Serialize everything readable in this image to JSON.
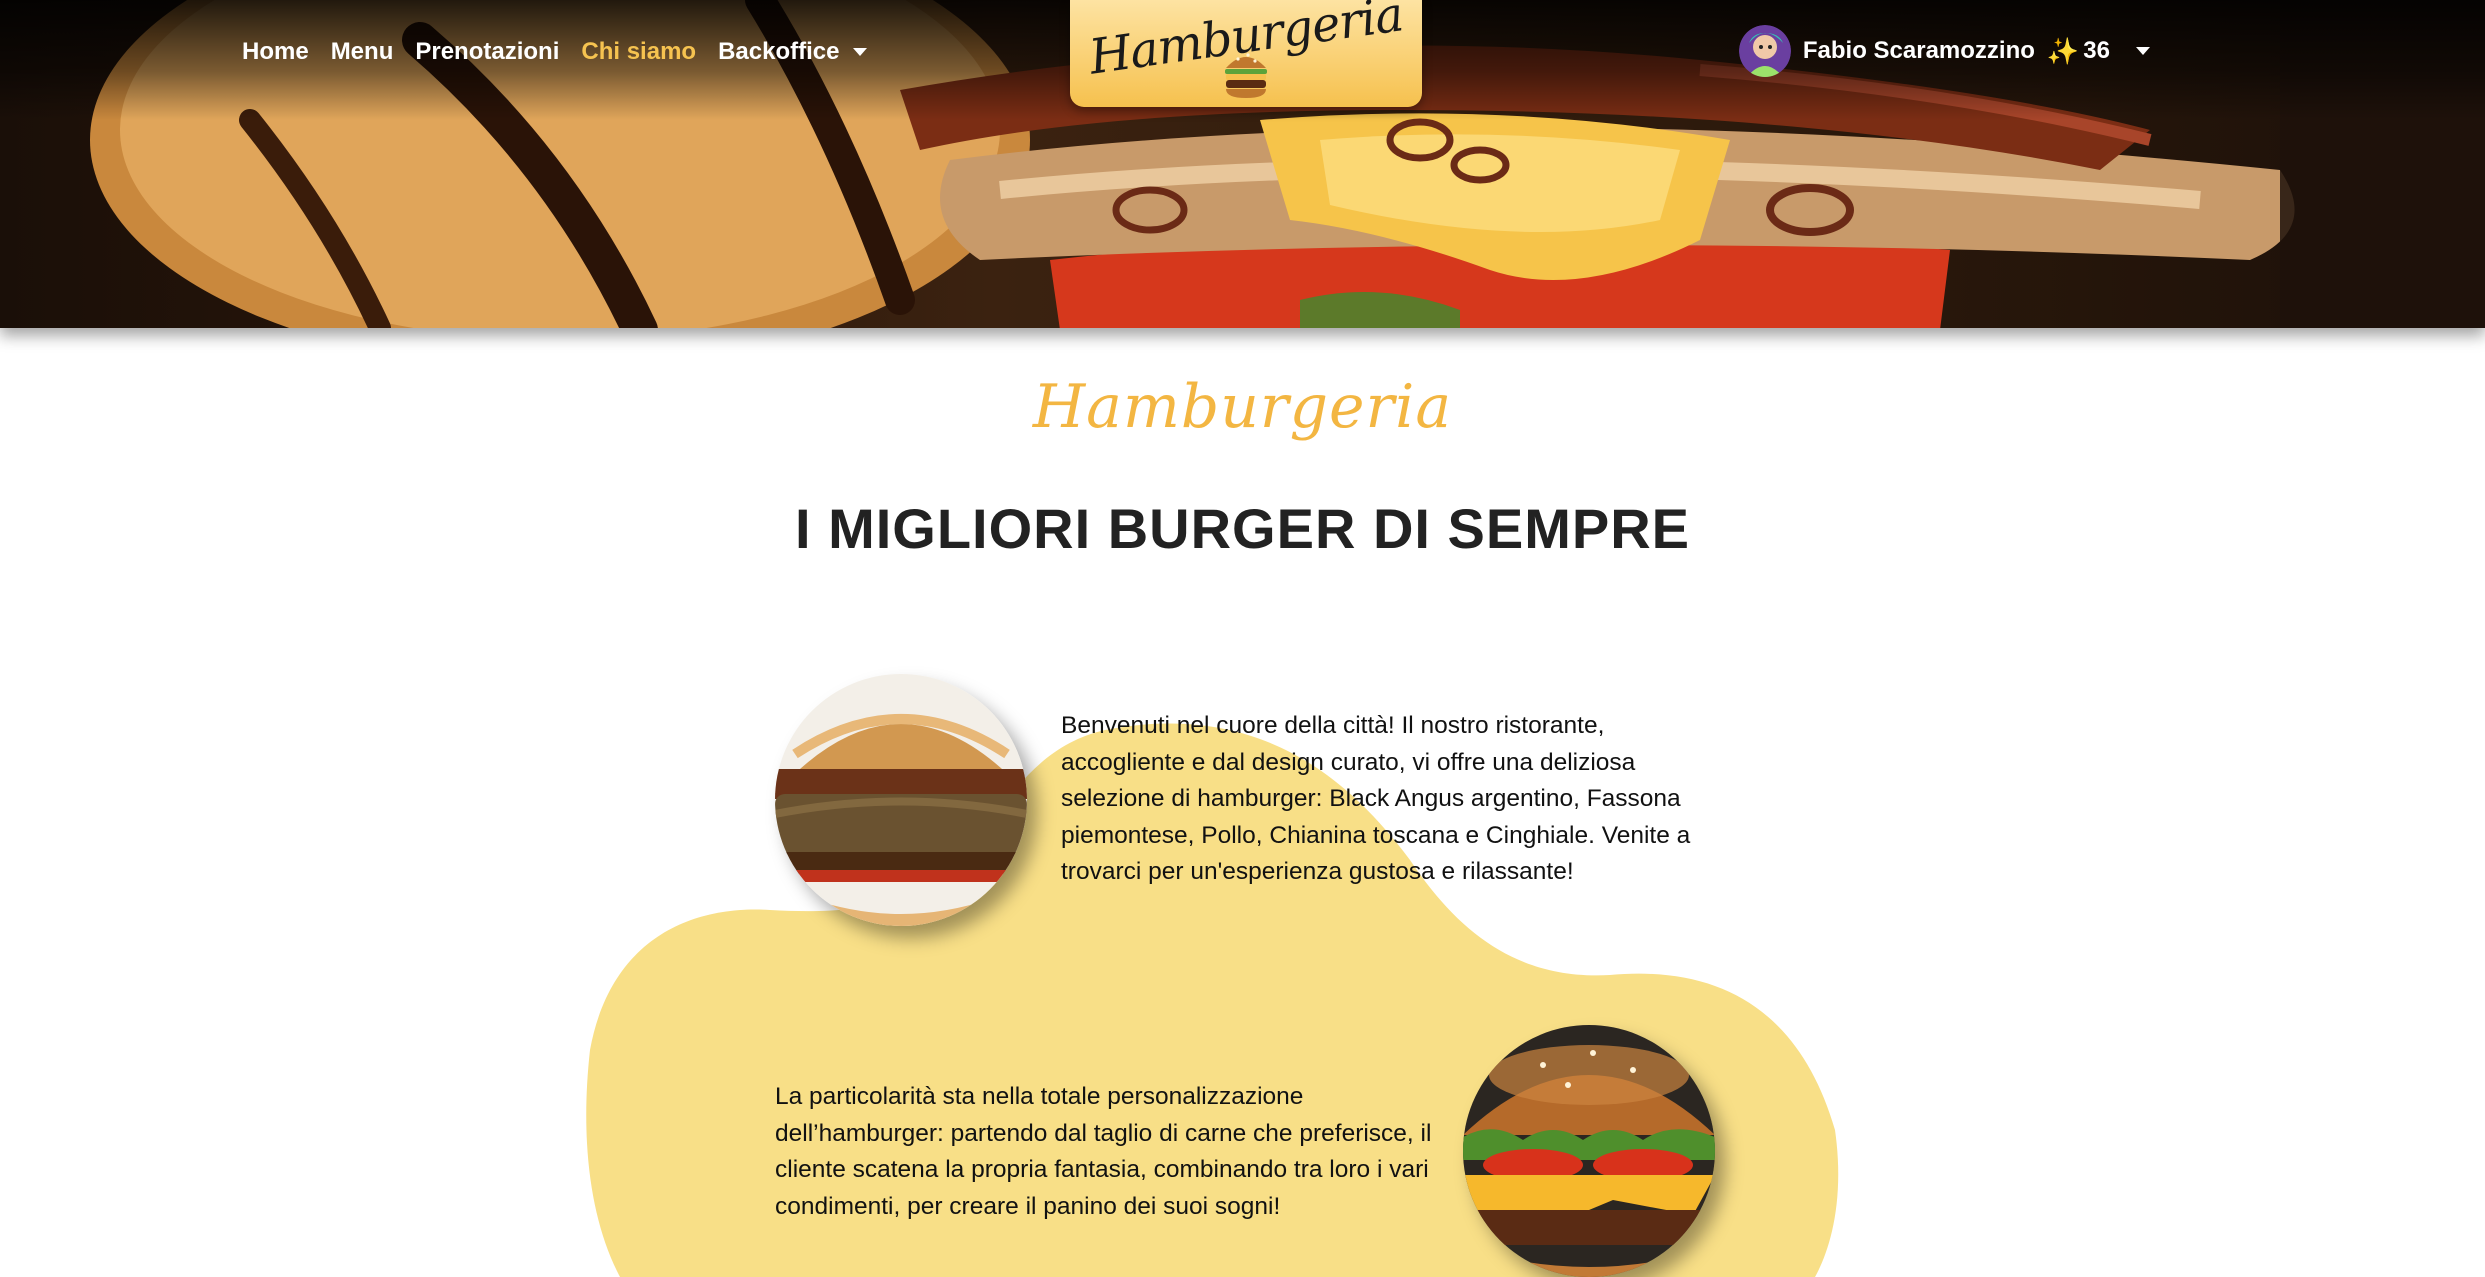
{
  "nav": {
    "links": [
      {
        "label": "Home",
        "active": false
      },
      {
        "label": "Menu",
        "active": false
      },
      {
        "label": "Prenotazioni",
        "active": false
      },
      {
        "label": "Chi siamo",
        "active": true
      },
      {
        "label": "Backoffice",
        "active": false,
        "dropdown": true
      }
    ],
    "brand": "Hamburgeria",
    "user": {
      "name": "Fabio Scaramozzino",
      "points_icon": "✨",
      "points": "36"
    }
  },
  "content": {
    "script_title": "Hamburgeria",
    "heading": "I MIGLIORI BURGER DI SEMPRE",
    "paragraph1": "Benvenuti nel cuore della città! Il nostro ristorante, accogliente e dal design curato, vi offre una deliziosa selezione di hamburger: Black Angus argentino, Fassona piemontese, Pollo, Chianina toscana e Cinghiale. Venite a trovarci per un'esperienza gustosa e rilassante!",
    "paragraph2": "La particolarità sta nella totale personalizzazione dell’hamburger: partendo dal taglio di carne che preferisce, il cliente scatena la propria fantasia, combinando tra loro i vari condimenti, per creare il panino dei suoi sogni!"
  },
  "colors": {
    "accent": "#f6c350",
    "blob": "#f8df87",
    "heading": "#222222"
  }
}
